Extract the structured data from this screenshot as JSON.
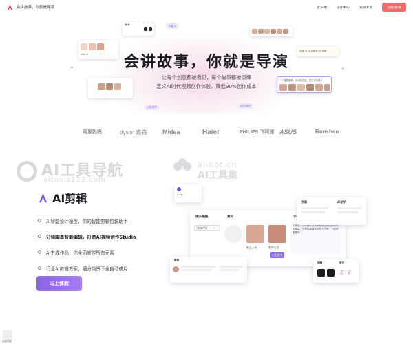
{
  "header": {
    "brand_text": "会讲故事，你就是导演",
    "nav": [
      "客户端",
      "设计中心",
      "会员专享"
    ],
    "cta_label": "注册/登录",
    "accent_color": "#ef6b6b"
  },
  "hero": {
    "title": "会讲故事，你就是导演",
    "subtitle_line1": "让每个创意都被看见，每个故事都被演绎",
    "subtitle_line2": "定义AI时代视频创作体验，降低90%创作成本",
    "chip_ai": "AI定义",
    "chip_ai_generate": "AI生成中",
    "bubble_text": "汤泉 以 生化危机 机 机器",
    "card_text": "一个高层建筑，中间向左前，在日光中被人",
    "phone_text": "1.在屏幕上出现一个屏幕"
  },
  "logos": [
    "阿里妈妈",
    "dyson 戴森",
    "Midea",
    "Haier",
    "PHILIPS 飞利浦",
    "ASUS",
    "Ronshen"
  ],
  "watermarks": {
    "brand1": "AI工具导航",
    "url1": "aitools123.com",
    "brand2_url": "ai-bot.cn",
    "brand2": "AI工具集"
  },
  "feature": {
    "title": "AI剪辑",
    "items": [
      {
        "label": "AI智能设计模型，你的智能剪辑包装助手",
        "active": false
      },
      {
        "label": "分镜脚本智能编辑，打造AI视频创作Studio",
        "active": true
      },
      {
        "label": "AI生成作品，你全面掌控所有元素",
        "active": false
      },
      {
        "label": "行业AI剪辑方案，细分场景下全自动成片",
        "active": false
      }
    ],
    "cta_label": "马上体验",
    "accent_color": "#8b5cf6"
  },
  "mockup": {
    "panel1_title": "镜头编整",
    "panel1_select": "卖点介绍",
    "panel2_title": "素材",
    "panel3_title": "字幕",
    "caption_label1": "新品上市",
    "caption_label2": "限时优惠",
    "script_text": "大家好！今天我们向大家推荐这款全新的水乳面霜，分享你最喜欢的配方护肤，一起来看看吧",
    "ai_write": "AI生成中",
    "side_title": "字幕",
    "side_ai": "AI生成",
    "side_text": "AI助手",
    "bottom_title": "配音",
    "music_title": "视频",
    "music_title2": "音乐"
  },
  "bottom": {
    "label": "回到顶部"
  }
}
